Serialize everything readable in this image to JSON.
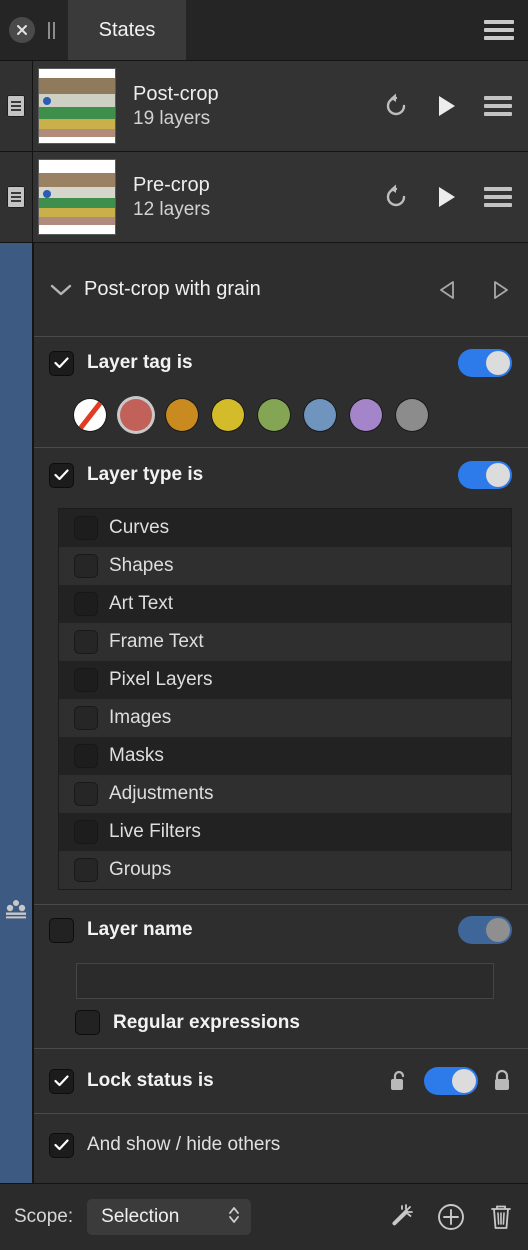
{
  "titlebar": {
    "close_icon": "close-circle-icon",
    "grip_icon": "pause-grip-icon",
    "tab_label": "States",
    "menu_icon": "hamburger-menu-icon"
  },
  "states": [
    {
      "title": "Post-crop",
      "subtitle": "19 layers",
      "doc_icon": "document-icon",
      "restore_icon": "restore-arrow-icon",
      "play_icon": "play-icon",
      "menu_icon": "hamburger-menu-icon"
    },
    {
      "title": "Pre-crop",
      "subtitle": "12 layers",
      "doc_icon": "document-icon",
      "restore_icon": "restore-arrow-icon",
      "play_icon": "play-icon",
      "menu_icon": "hamburger-menu-icon"
    }
  ],
  "rail": {
    "icon": "people-group-icon"
  },
  "section": {
    "title": "Post-crop with grain",
    "collapse_icon": "chevron-down-icon",
    "prev_icon": "triangle-left-icon",
    "next_icon": "triangle-right-icon"
  },
  "layer_tag": {
    "label": "Layer tag is",
    "checked": true,
    "toggle_on": true,
    "swatches": [
      {
        "name": "none",
        "color": "#ffffff",
        "selected": false
      },
      {
        "name": "red",
        "color": "#c2615a",
        "selected": true
      },
      {
        "name": "orange",
        "color": "#c98a1f",
        "selected": false
      },
      {
        "name": "yellow",
        "color": "#d3bb2a",
        "selected": false
      },
      {
        "name": "green",
        "color": "#84a553",
        "selected": false
      },
      {
        "name": "blue",
        "color": "#6f94bd",
        "selected": false
      },
      {
        "name": "purple",
        "color": "#a585c9",
        "selected": false
      },
      {
        "name": "gray",
        "color": "#8c8c8c",
        "selected": false
      }
    ]
  },
  "layer_type": {
    "label": "Layer type is",
    "checked": true,
    "toggle_on": true,
    "items": [
      {
        "label": "Curves",
        "checked": false
      },
      {
        "label": "Shapes",
        "checked": false
      },
      {
        "label": "Art Text",
        "checked": false
      },
      {
        "label": "Frame Text",
        "checked": false
      },
      {
        "label": "Pixel Layers",
        "checked": false
      },
      {
        "label": "Images",
        "checked": false
      },
      {
        "label": "Masks",
        "checked": false
      },
      {
        "label": "Adjustments",
        "checked": false
      },
      {
        "label": "Live Filters",
        "checked": false
      },
      {
        "label": "Groups",
        "checked": false
      }
    ]
  },
  "layer_name": {
    "label": "Layer name",
    "checked": false,
    "toggle_on": true,
    "toggle_dimmed": true,
    "input_value": "",
    "input_placeholder": "",
    "regex_label": "Regular expressions",
    "regex_checked": false
  },
  "lock_status": {
    "label": "Lock status is",
    "checked": true,
    "toggle_on": true,
    "unlock_icon": "unlock-icon",
    "lock_icon": "lock-icon"
  },
  "show_hide": {
    "label": "And show / hide others",
    "checked": true
  },
  "footer": {
    "scope_label": "Scope:",
    "scope_value": "Selection",
    "stepper_icon": "stepper-updown-icon",
    "wand_icon": "magic-wand-icon",
    "add_icon": "plus-circle-icon",
    "delete_icon": "trash-icon"
  },
  "colors": {
    "accent_blue": "#2d7bea",
    "rail_blue": "#3c5a82",
    "panel_bg": "#2e2e2e",
    "titlebar_bg": "#252525"
  }
}
